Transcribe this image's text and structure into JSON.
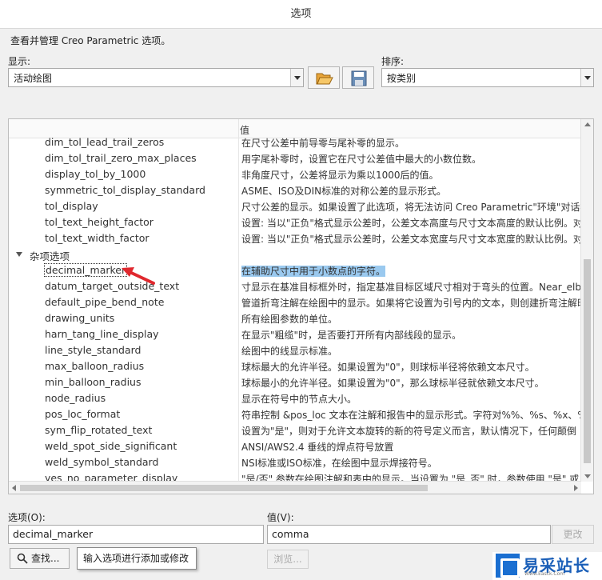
{
  "window": {
    "title": "选项"
  },
  "description": "查看并管理 Creo Parametric 选项。",
  "display": {
    "label": "显示:",
    "value": "活动绘图"
  },
  "sort": {
    "label": "排序:",
    "value": "按类别"
  },
  "list": {
    "header_col2": "值",
    "rows": [
      {
        "name": "dim_tol_lead_trail_zeros",
        "desc": "在尺寸公差中前导零与尾补零的显示。"
      },
      {
        "name": "dim_tol_trail_zero_max_places",
        "desc": "用字尾补零时，设置它在尺寸公差值中最大的小数位数。"
      },
      {
        "name": "display_tol_by_1000",
        "desc": "非角度尺寸，公差将显示为乘以1000后的值。"
      },
      {
        "name": "symmetric_tol_display_standard",
        "desc": "ASME、ISO及DIN标准的对称公差的显示形式。"
      },
      {
        "name": "tol_display",
        "desc": "尺寸公差的显示。如果设置了此选项，将无法访问 Creo Parametric\"环境\"对话框"
      },
      {
        "name": "tol_text_height_factor",
        "desc": "设置: 当以\"正负\"格式显示公差时，公差文本高度与尺寸文本高度的默认比例。对"
      },
      {
        "name": "tol_text_width_factor",
        "desc": "设置: 当以\"正负\"格式显示公差时，公差文本宽度与尺寸文本宽度的默认比例。对"
      },
      {
        "name": "杂项选项",
        "desc": "",
        "group": true
      },
      {
        "name": "decimal_marker",
        "desc": "在辅助尺寸中用于小数点的字符。",
        "selected": true
      },
      {
        "name": "datum_target_outside_text",
        "desc": "寸显示在基准目标框外时，指定基准目标区域尺寸相对于弯头的位置。Near_elb"
      },
      {
        "name": "default_pipe_bend_note",
        "desc": "管道折弯注解在绘图中的显示。如果将它设置为引号内的文本，则创建折弯注解时"
      },
      {
        "name": "drawing_units",
        "desc": "所有绘图参数的单位。"
      },
      {
        "name": "harn_tang_line_display",
        "desc": "在显示\"粗缆\"时，是否要打开所有内部线段的显示。"
      },
      {
        "name": "line_style_standard",
        "desc": "绘图中的线显示标准。"
      },
      {
        "name": "max_balloon_radius",
        "desc": "球标最大的允许半径。如果设置为\"0\"，则球标半径将依赖文本尺寸。"
      },
      {
        "name": "min_balloon_radius",
        "desc": "球标最小的允许半径。如果设置为\"0\"，那么球标半径就依赖文本尺寸。"
      },
      {
        "name": "node_radius",
        "desc": "显示在符号中的节点大小。"
      },
      {
        "name": "pos_loc_format",
        "desc": "符串控制 &pos_loc 文本在注解和报告中的显示形式。字符对%%、%s、%x、%"
      },
      {
        "name": "sym_flip_rotated_text",
        "desc": "设置为\"是\"，则对于允许文本旋转的新的符号定义而言，默认情况下，任何颠倒"
      },
      {
        "name": "weld_spot_side_significant",
        "desc": "ANSI/AWS2.4 垂线的焊点符号放置"
      },
      {
        "name": "weld_symbol_standard",
        "desc": "NSI标准或ISO标准，在绘图中显示焊接符号。"
      },
      {
        "name": "yes_no_parameter_display",
        "desc": "\"是/否\" 参数在绘图注解和表中的显示。当设置为 \"是_否\" 时，参数使用 \"是\" 或"
      }
    ]
  },
  "option": {
    "label": "选项(O):",
    "value": "decimal_marker"
  },
  "value": {
    "label": "值(V):",
    "value": "comma"
  },
  "buttons": {
    "find": "查找...",
    "browse": "浏览...",
    "change": "更改"
  },
  "tooltip": "输入选项进行添加或修改",
  "watermark": {
    "text": "易采站长站",
    "sub": "Www.Easck.Com"
  },
  "colors": {
    "selection": "#9ac9ef",
    "arrow": "#e0282e",
    "logo": "#1b5fb8"
  }
}
